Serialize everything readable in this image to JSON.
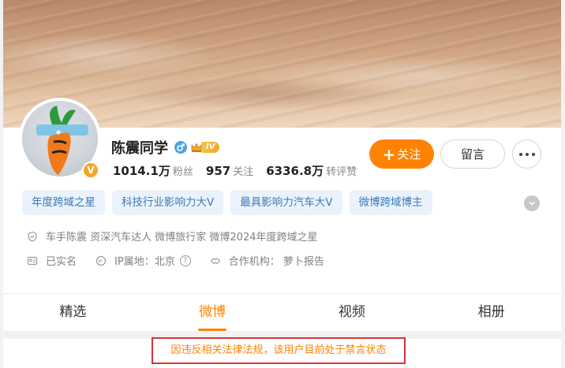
{
  "profile": {
    "name": "陈震同学",
    "vip_level": "IV",
    "verified_badge": "V"
  },
  "stats": [
    {
      "num": "1014.1万",
      "label": "粉丝"
    },
    {
      "num": "957",
      "label": "关注"
    },
    {
      "num": "6336.8万",
      "label": "转评赞"
    }
  ],
  "actions": {
    "follow_plus": "+",
    "follow_label": "关注",
    "message_label": "留言"
  },
  "tags": [
    "年度跨域之星",
    "科技行业影响力大V",
    "最具影响力汽车大V",
    "微博跨域博主"
  ],
  "info": {
    "bio": "车手陈震 资深汽车达人 微博旅行家 微博2024年度跨域之星",
    "real_name": "已实名",
    "ip_location": "IP属地：北京",
    "partner": "合作机构： 萝卜报告",
    "help_glyph": "?"
  },
  "tabs": [
    "精选",
    "微博",
    "视频",
    "相册"
  ],
  "active_tab": "微博",
  "notice": "因违反相关法律法规，该用户目前处于禁言状态",
  "colors": {
    "accent": "#ff8200",
    "tag_bg": "#eaf3fb",
    "tag_text": "#3d7ab8",
    "notice_border": "#d9313a"
  }
}
